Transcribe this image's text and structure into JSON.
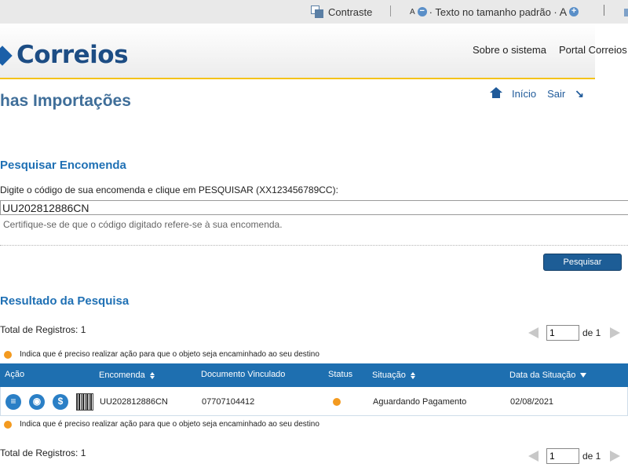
{
  "topbar": {
    "contrast_label": "Contraste",
    "font_small": "A",
    "font_minus": "−",
    "font_default": "· Texto no tamanho padrão  ·",
    "font_large": "A",
    "font_plus": "+"
  },
  "header": {
    "logo_text": "Correios",
    "links": [
      "Sobre o sistema",
      "Portal Correios"
    ]
  },
  "page": {
    "title": "has Importações",
    "nav": {
      "inicio": "Início",
      "sair": "Sair"
    }
  },
  "search": {
    "section_title": "Pesquisar Encomenda",
    "instruction": "Digite o código de sua encomenda e clique em PESQUISAR (XX123456789CC):",
    "value": "UU202812886CN",
    "hint": "Certifique-se de que o código digitado refere-se à sua encomenda.",
    "button_label": "Pesquisar"
  },
  "results": {
    "section_title": "Resultado da Pesquisa",
    "total_label": "Total de Registros: 1",
    "pager": {
      "current": "1",
      "of_label": "de 1"
    },
    "legend": "Indica que é preciso realizar ação para que o objeto seja encaminhado ao seu destino",
    "columns": [
      "Ação",
      "Encomenda",
      "Documento Vinculado",
      "Status",
      "Situação",
      "Data da Situação"
    ],
    "rows": [
      {
        "encomenda": "UU202812886CN",
        "documento": "07707104412",
        "situacao": "Aguardando Pagamento",
        "data": "02/08/2021"
      }
    ]
  },
  "colors": {
    "brand_blue": "#1d4d84",
    "table_header": "#1e6fb0",
    "accent_yellow": "#f4c31a",
    "status_orange": "#f39a1f"
  },
  "icons": [
    "contrast-icon",
    "font-decrease-icon",
    "font-increase-icon",
    "home-icon",
    "exit-icon",
    "details-icon",
    "view-icon",
    "payment-icon",
    "barcode-icon"
  ]
}
